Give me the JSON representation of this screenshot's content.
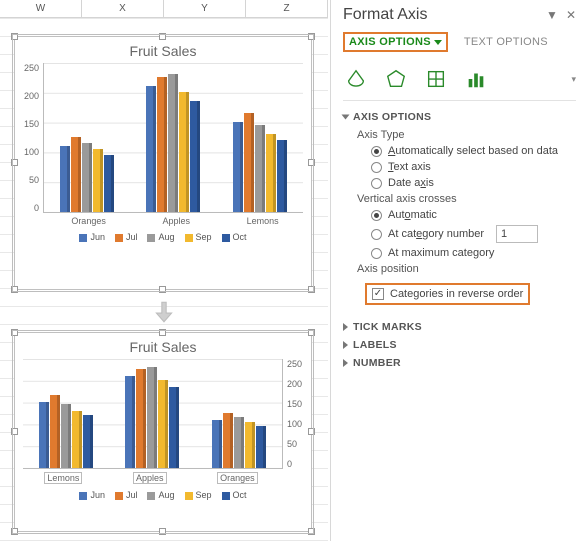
{
  "columns": [
    "W",
    "X",
    "Y",
    "Z"
  ],
  "chart1": {
    "title": "Fruit Sales",
    "categories": [
      "Oranges",
      "Apples",
      "Lemons"
    ],
    "yticks": [
      "250",
      "200",
      "150",
      "100",
      "50",
      "0"
    ]
  },
  "chart2": {
    "title": "Fruit Sales",
    "categories": [
      "Lemons",
      "Apples",
      "Oranges"
    ],
    "yticks": [
      "250",
      "200",
      "150",
      "100",
      "50",
      "0"
    ]
  },
  "legend": [
    "Jun",
    "Jul",
    "Aug",
    "Sep",
    "Oct"
  ],
  "colors": {
    "Jun": "#4a74b8",
    "Jul": "#e07a2e",
    "Aug": "#9a9a9a",
    "Sep": "#f2b92e",
    "Oct": "#2e5aa0"
  },
  "chart_data": [
    {
      "type": "bar",
      "title": "Fruit Sales",
      "categories": [
        "Oranges",
        "Apples",
        "Lemons"
      ],
      "series": [
        {
          "name": "Jun",
          "values": [
            110,
            210,
            150
          ]
        },
        {
          "name": "Jul",
          "values": [
            125,
            225,
            165
          ]
        },
        {
          "name": "Aug",
          "values": [
            115,
            230,
            145
          ]
        },
        {
          "name": "Sep",
          "values": [
            105,
            200,
            130
          ]
        },
        {
          "name": "Oct",
          "values": [
            95,
            185,
            120
          ]
        }
      ],
      "ylim": [
        0,
        250
      ],
      "ylabel": "",
      "xlabel": ""
    },
    {
      "type": "bar",
      "title": "Fruit Sales",
      "categories": [
        "Lemons",
        "Apples",
        "Oranges"
      ],
      "series": [
        {
          "name": "Jun",
          "values": [
            150,
            210,
            110
          ]
        },
        {
          "name": "Jul",
          "values": [
            165,
            225,
            125
          ]
        },
        {
          "name": "Aug",
          "values": [
            145,
            230,
            115
          ]
        },
        {
          "name": "Sep",
          "values": [
            130,
            200,
            105
          ]
        },
        {
          "name": "Oct",
          "values": [
            120,
            185,
            95
          ]
        }
      ],
      "ylim": [
        0,
        250
      ],
      "ylabel": "",
      "xlabel": ""
    }
  ],
  "pane": {
    "title": "Format Axis",
    "tab_axis": "AXIS OPTIONS",
    "tab_text": "TEXT OPTIONS",
    "sect_axis": "AXIS OPTIONS",
    "axis_type_label": "Axis Type",
    "r_auto": "Automatically select based on data",
    "r_text": "Text axis",
    "r_date": "Date axis",
    "vcross_label": "Vertical axis crosses",
    "r_vauto": "Automatic",
    "r_catnum": "At category number",
    "catnum_val": "1",
    "r_max": "At maximum category",
    "axispos_label": "Axis position",
    "chk_reverse": "Categories in reverse order",
    "sect_tick": "TICK MARKS",
    "sect_labels": "LABELS",
    "sect_number": "NUMBER"
  }
}
